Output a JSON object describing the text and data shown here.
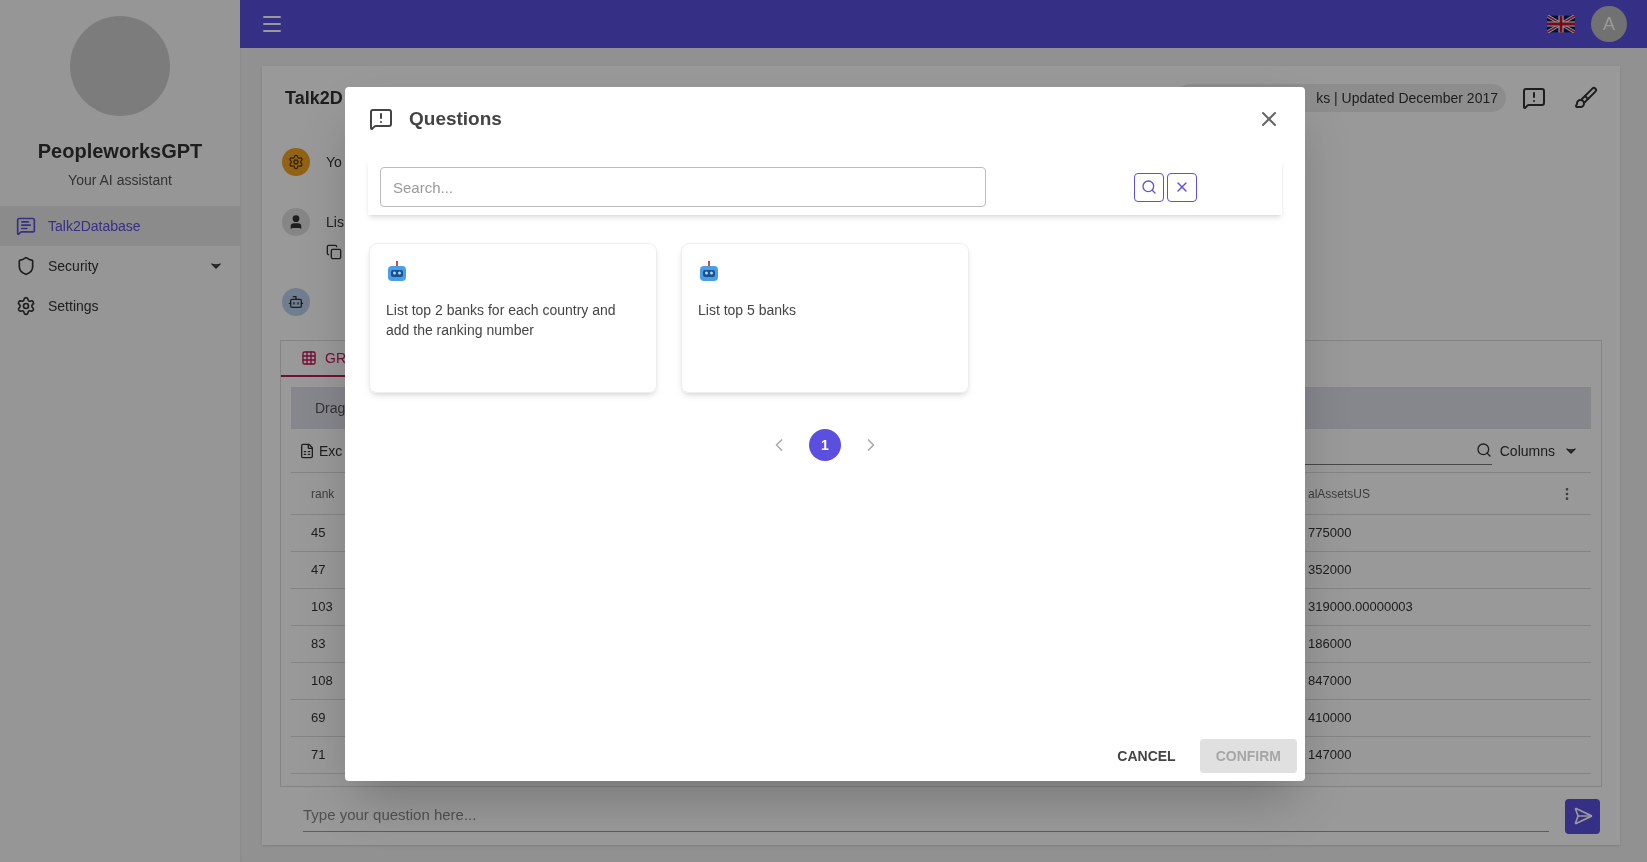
{
  "sidebar": {
    "app_name": "PeopleworksGPT",
    "subtitle": "Your AI assistant",
    "items": [
      {
        "kind": "chat",
        "label": "Talk2Database",
        "selected": true,
        "has_submenu": false
      },
      {
        "kind": "shield",
        "label": "Security",
        "selected": false,
        "has_submenu": true
      },
      {
        "kind": "gear",
        "label": "Settings",
        "selected": false,
        "has_submenu": false
      }
    ]
  },
  "top_bar": {
    "avatar_letter": "A"
  },
  "page": {
    "title": "Talk2D",
    "dataset_chip": "ks | Updated December 2017",
    "messages": [
      {
        "kind": "system",
        "text": "Yo"
      },
      {
        "kind": "user",
        "text": "Lis"
      },
      {
        "kind": "bot"
      }
    ],
    "result_tab": {
      "label": "GR",
      "selected": true
    },
    "grid": {
      "drag_hint": "Drag",
      "export_label": "Exc",
      "columns_button": "Columns",
      "columns": [
        "rank",
        "alAssetsUS"
      ],
      "rows": [
        [
          "45",
          "775000"
        ],
        [
          "47",
          "352000"
        ],
        [
          "103",
          "319000.00000003"
        ],
        [
          "83",
          "186000"
        ],
        [
          "108",
          "847000"
        ],
        [
          "69",
          "410000"
        ],
        [
          "71",
          "147000"
        ]
      ]
    },
    "question_input": {
      "placeholder": "Type your question here..."
    }
  },
  "dialog": {
    "title": "Questions",
    "search": {
      "placeholder": "Search..."
    },
    "cards": [
      {
        "text": "List top 2 banks for each country and add the ranking number"
      },
      {
        "text": "List top 5 banks"
      }
    ],
    "pagination": [
      {
        "label": "1",
        "selected": true
      }
    ],
    "buttons": [
      {
        "label": "CANCEL",
        "disabled": false
      },
      {
        "label": "CONFIRM",
        "disabled": true
      }
    ]
  }
}
